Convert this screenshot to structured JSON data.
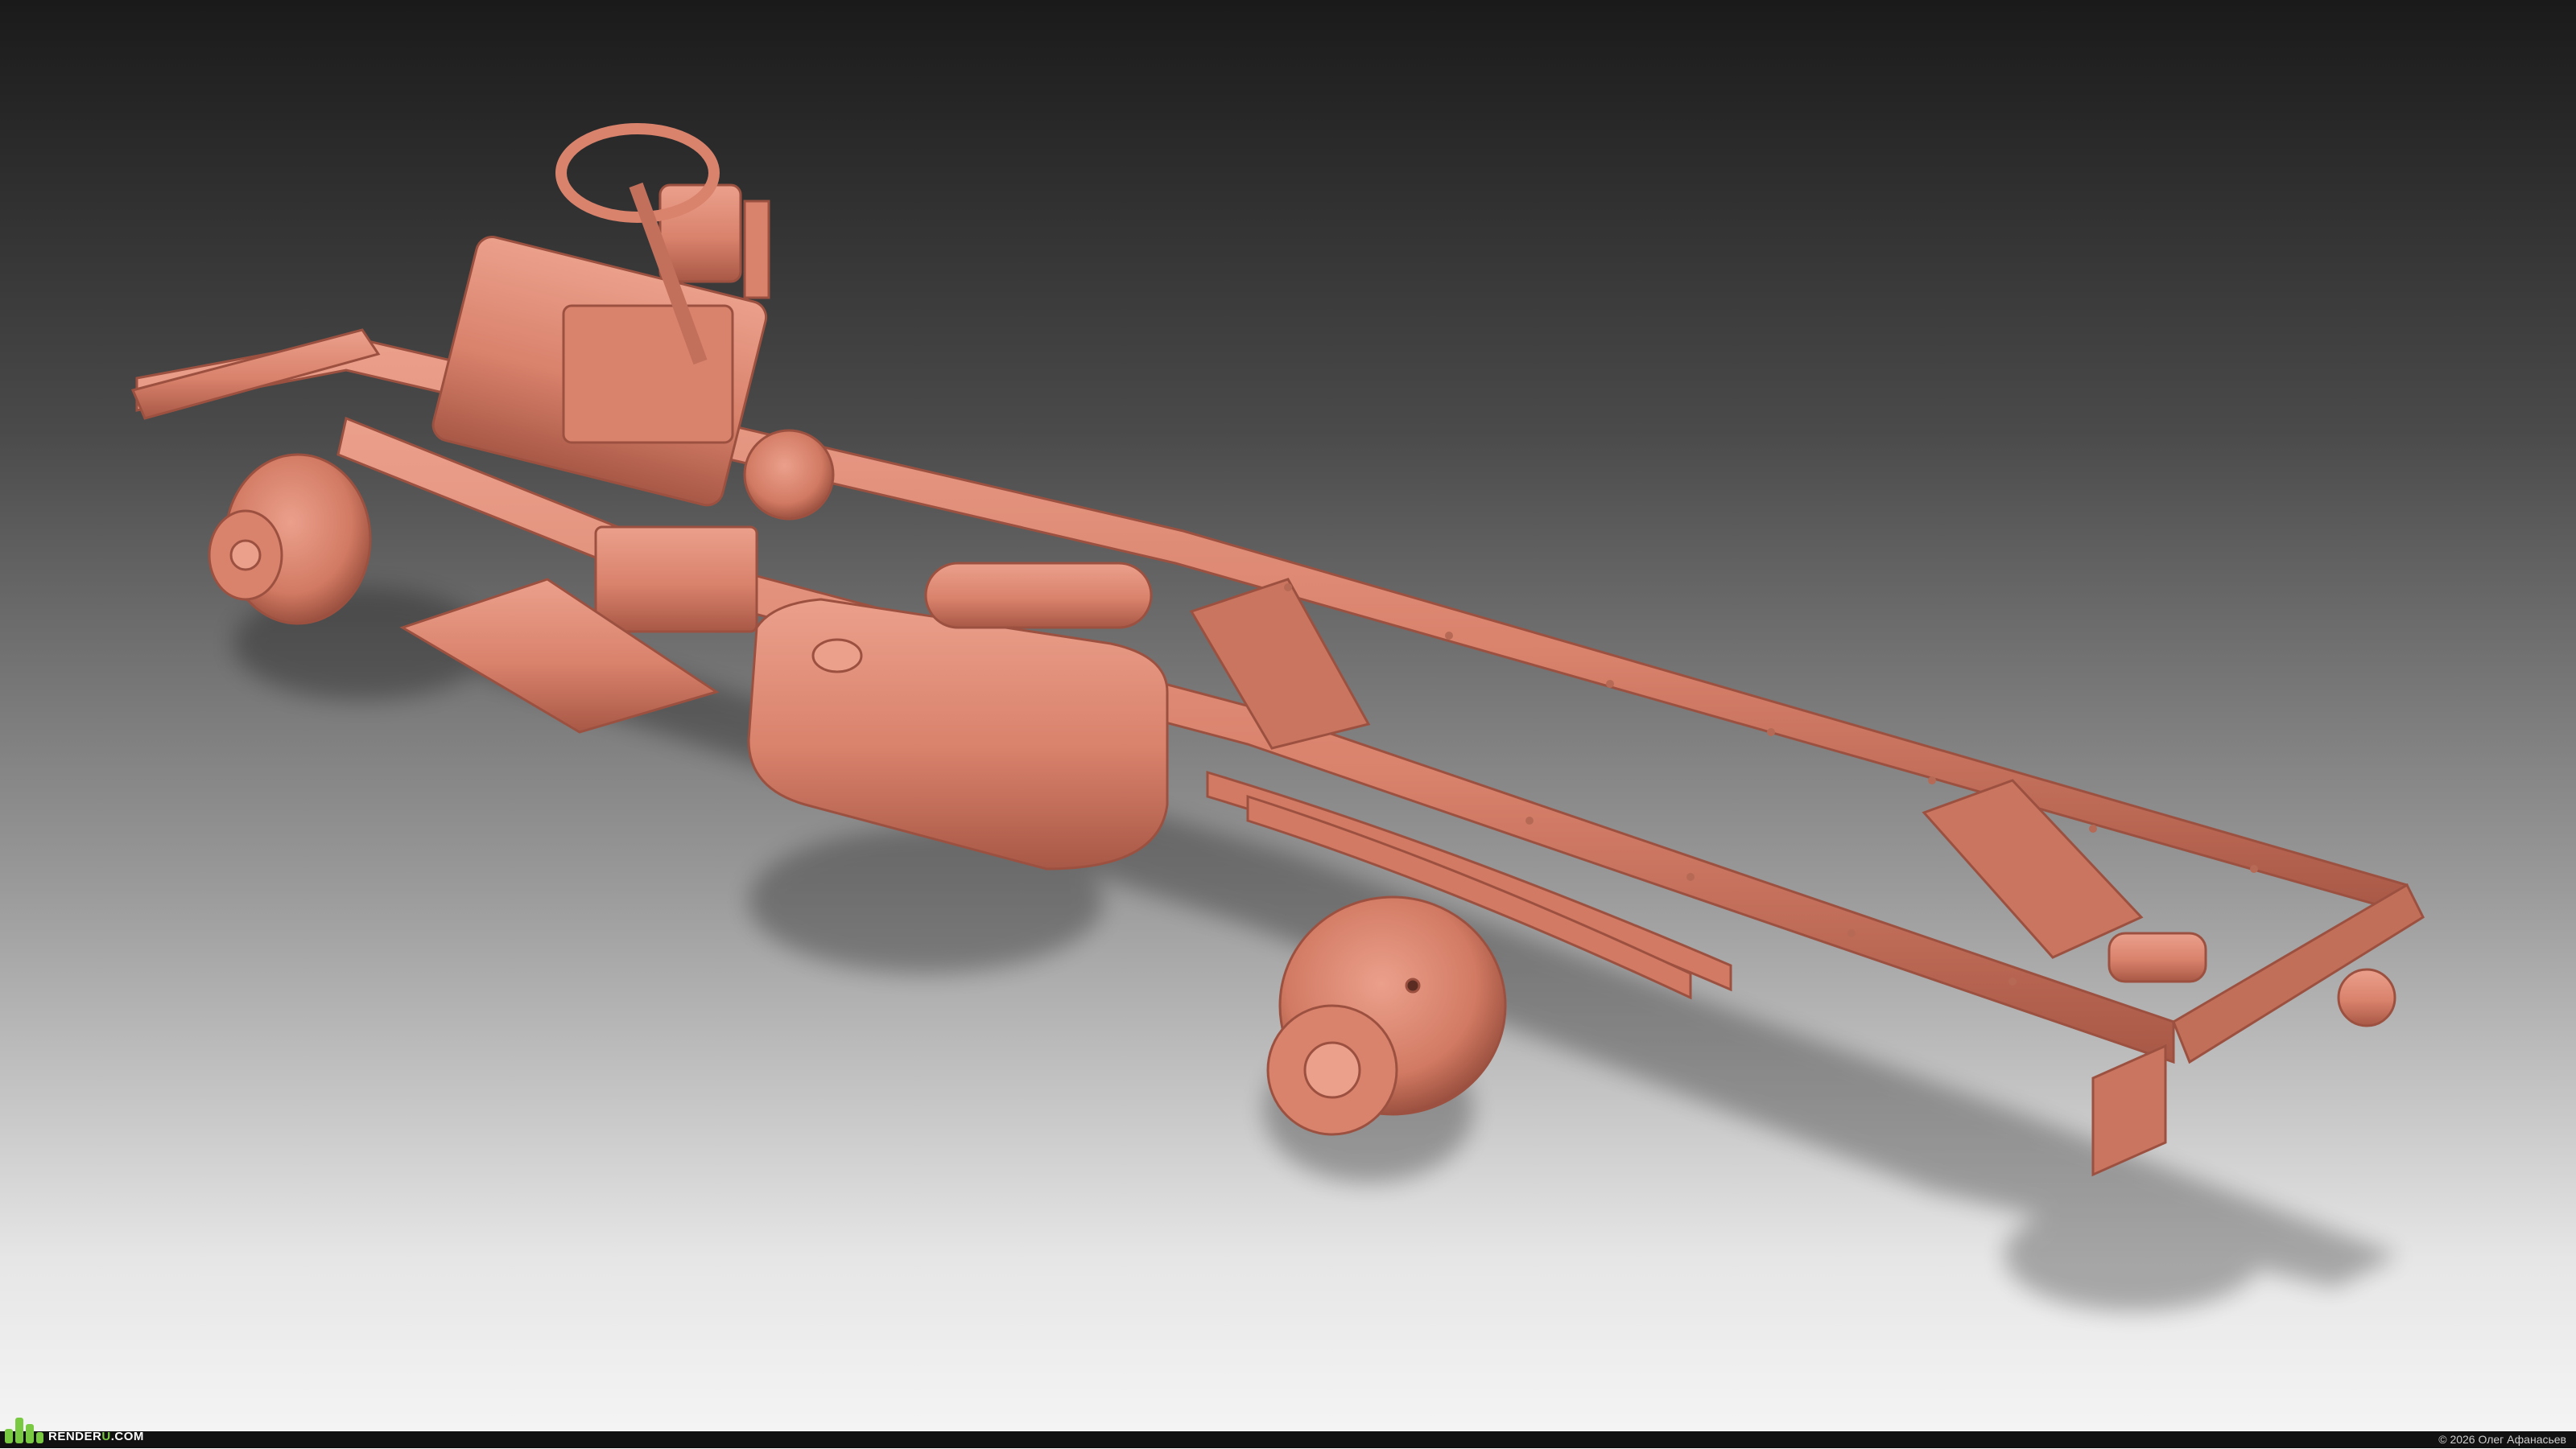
{
  "watermark": {
    "brand_prefix": "RENDER",
    "brand_accent": "U",
    "brand_suffix": ".COM",
    "icon": "bar-chart-logo-icon",
    "accent_color": "#7ac943"
  },
  "credit": "© 2026 Олег Афанасьев",
  "colors": {
    "clay": "#d9826c",
    "clay_dark": "#a85846",
    "clay_light": "#eba08c",
    "background_top": "#1a1a1a",
    "background_bottom": "#f4f4f4"
  }
}
